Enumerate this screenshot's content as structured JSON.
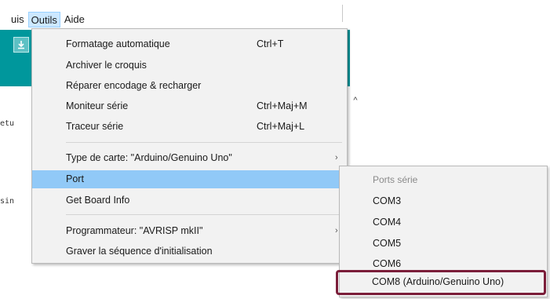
{
  "menubar": {
    "items": [
      {
        "label": "uis"
      },
      {
        "label": "Outils"
      },
      {
        "label": "Aide"
      }
    ]
  },
  "editor": {
    "code_line_1": "etu",
    "code_line_2": "sin",
    "toolbar_icon": "download-icon",
    "scroll_up_glyph": "^"
  },
  "tools_menu": {
    "items": [
      {
        "label": "Formatage automatique",
        "shortcut": "Ctrl+T"
      },
      {
        "label": "Archiver le croquis",
        "shortcut": ""
      },
      {
        "label": "Réparer encodage & recharger",
        "shortcut": ""
      },
      {
        "label": "Moniteur série",
        "shortcut": "Ctrl+Maj+M"
      },
      {
        "label": "Traceur série",
        "shortcut": "Ctrl+Maj+L"
      },
      {
        "label": "Type de carte: \"Arduino/Genuino Uno\"",
        "shortcut": ""
      },
      {
        "label": "Port",
        "shortcut": ""
      },
      {
        "label": "Get Board Info",
        "shortcut": ""
      },
      {
        "label": "Programmateur: \"AVRISP mkII\"",
        "shortcut": ""
      },
      {
        "label": "Graver la séquence d'initialisation",
        "shortcut": ""
      }
    ],
    "submenu_arrow": "›"
  },
  "port_submenu": {
    "header": "Ports série",
    "items": [
      {
        "label": "COM3"
      },
      {
        "label": "COM4"
      },
      {
        "label": "COM5"
      },
      {
        "label": "COM6"
      },
      {
        "label": "COM8 (Arduino/Genuino Uno)"
      }
    ]
  },
  "colors": {
    "teal": "#00979c",
    "highlight": "#91c9f7",
    "selection_border": "#7b1e3a"
  }
}
